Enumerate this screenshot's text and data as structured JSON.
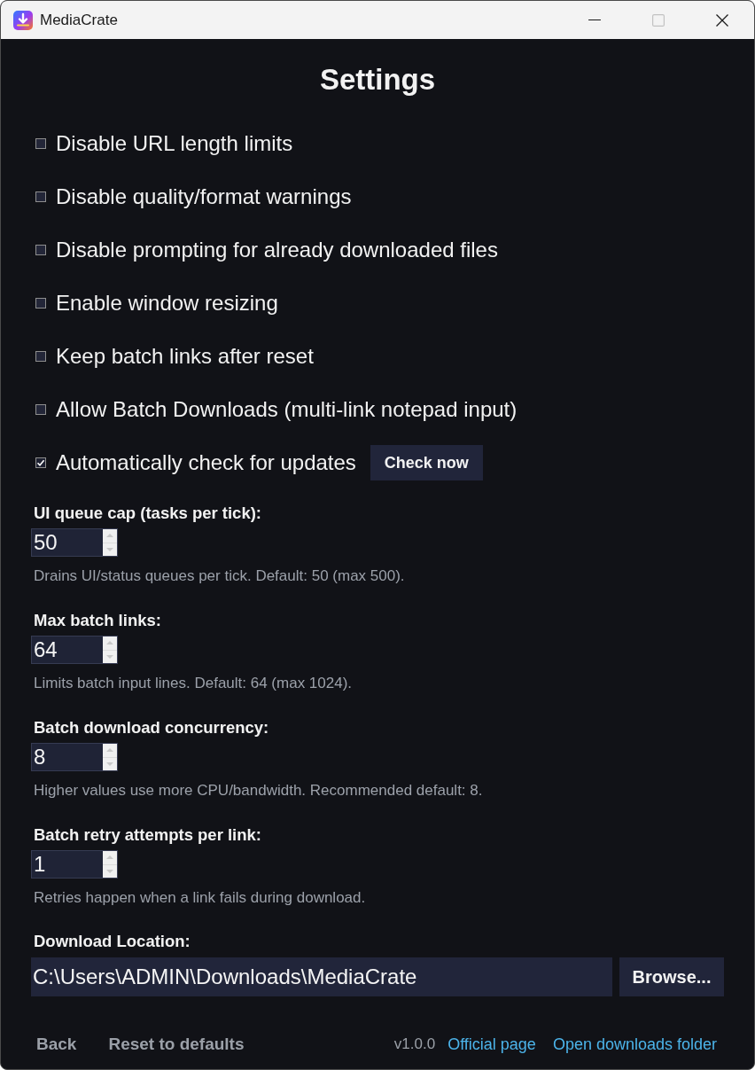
{
  "window": {
    "title": "MediaCrate",
    "controls": [
      {
        "kind": "minimize",
        "disabled": false
      },
      {
        "kind": "maximize",
        "disabled": true
      },
      {
        "kind": "close",
        "disabled": false
      }
    ]
  },
  "heading": "Settings",
  "options": [
    {
      "label": "Disable URL length limits",
      "checked": false
    },
    {
      "label": "Disable quality/format warnings",
      "checked": false
    },
    {
      "label": "Disable prompting for already downloaded files",
      "checked": false
    },
    {
      "label": "Enable window resizing",
      "checked": false
    },
    {
      "label": "Keep batch links after reset",
      "checked": false
    },
    {
      "label": "Allow Batch Downloads (multi-link notepad input)",
      "checked": false
    },
    {
      "label": "Automatically check for updates",
      "checked": true,
      "button": "Check now"
    }
  ],
  "number_fields": [
    {
      "label": "UI queue cap (tasks per tick):",
      "value": "50",
      "help": "Drains UI/status queues per tick. Default: 50 (max 500)."
    },
    {
      "label": "Max batch links:",
      "value": "64",
      "help": "Limits batch input lines. Default: 64 (max 1024)."
    },
    {
      "label": "Batch download concurrency:",
      "value": "8",
      "help": "Higher values use more CPU/bandwidth. Recommended default: 8."
    },
    {
      "label": "Batch retry attempts per link:",
      "value": "1",
      "help": "Retries happen when a link fails during download."
    }
  ],
  "download_location": {
    "label": "Download Location:",
    "value": "C:\\Users\\ADMIN\\Downloads\\MediaCrate",
    "button": "Browse..."
  },
  "footer": {
    "buttons": [
      "Back",
      "Reset to defaults"
    ],
    "version": "v1.0.0",
    "links": [
      "Official page",
      "Open downloads folder"
    ]
  }
}
